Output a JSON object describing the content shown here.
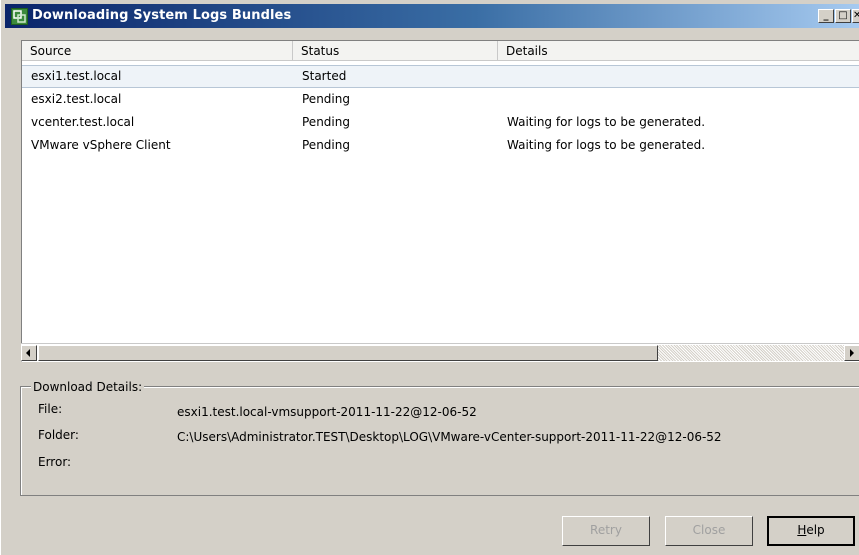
{
  "window": {
    "title": "Downloading System Logs Bundles",
    "controls": {
      "minimize": "_",
      "maximize": "□",
      "close": "✕"
    }
  },
  "list": {
    "columns": [
      "Source",
      "Status",
      "Details"
    ],
    "rows": [
      {
        "source": "esxi1.test.local",
        "status": "Started",
        "details": "",
        "selected": true
      },
      {
        "source": "esxi2.test.local",
        "status": "Pending",
        "details": ""
      },
      {
        "source": "vcenter.test.local",
        "status": "Pending",
        "details": "Waiting for logs to be generated."
      },
      {
        "source": "VMware vSphere Client",
        "status": "Pending",
        "details": "Waiting for logs to be generated."
      }
    ]
  },
  "download_details": {
    "legend": "Download Details:",
    "file_label": "File:",
    "file_value": "esxi1.test.local-vmsupport-2011-11-22@12-06-52",
    "folder_label": "Folder:",
    "folder_value": "C:\\Users\\Administrator.TEST\\Desktop\\LOG\\VMware-vCenter-support-2011-11-22@12-06-52",
    "error_label": "Error:",
    "error_value": ""
  },
  "buttons": {
    "retry": "Retry",
    "close": "Close",
    "help_underlined": "H",
    "help_rest": "elp"
  },
  "colors": {
    "title_gradient_start": "#0a246a",
    "title_gradient_end": "#a6caf0",
    "selected_row": "#eef3f8",
    "dialog_face": "#d4d0c8"
  },
  "icons": {
    "title": "vsphere-logo-icon",
    "scroll_left": "arrow-left-icon",
    "scroll_right": "arrow-right-icon"
  }
}
